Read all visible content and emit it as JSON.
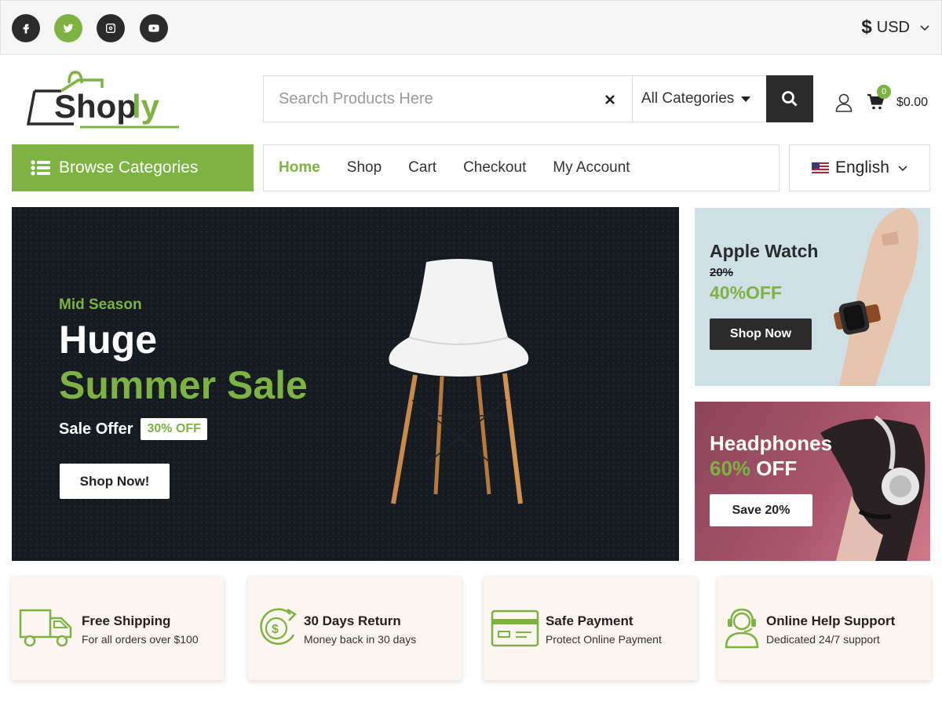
{
  "topbar": {
    "socials": [
      {
        "name": "facebook-icon"
      },
      {
        "name": "twitter-icon",
        "active": true
      },
      {
        "name": "instagram-icon"
      },
      {
        "name": "youtube-icon"
      }
    ],
    "currency": {
      "symbol": "$",
      "code": "USD"
    }
  },
  "header": {
    "logo_text": "Shoply",
    "search": {
      "placeholder": "Search Products Here",
      "value": ""
    },
    "category_select": "All Categories",
    "cart": {
      "count": "0",
      "total": "$0.00"
    }
  },
  "nav": {
    "browse_label": "Browse Categories",
    "links": [
      "Home",
      "Shop",
      "Cart",
      "Checkout",
      "My Account"
    ],
    "active": "Home",
    "language": "English"
  },
  "hero": {
    "subtitle": "Mid Season",
    "title_line1": "Huge",
    "title_line2": "Summer Sale",
    "offer_label": "Sale Offer",
    "offer_badge": "30% OFF",
    "button": "Shop Now!"
  },
  "banner_watch": {
    "title": "Apple Watch",
    "old_discount": "20%",
    "new_discount": "40%OFF",
    "button": "Shop Now"
  },
  "banner_headphones": {
    "title": "Headphones",
    "discount": "60%",
    "discount_suffix": "OFF",
    "button": "Save 20%"
  },
  "features": [
    {
      "title": "Free Shipping",
      "desc": "For all orders over $100",
      "icon": "truck-icon"
    },
    {
      "title": "30 Days Return",
      "desc": "Money back in 30 days",
      "icon": "money-return-icon"
    },
    {
      "title": "Safe Payment",
      "desc": "Protect Online Payment",
      "icon": "credit-card-icon"
    },
    {
      "title": "Online Help Support",
      "desc": "Dedicated 24/7 support",
      "icon": "support-agent-icon"
    }
  ],
  "colors": {
    "accent": "#7cb342",
    "dark": "#2b2b2b",
    "feature_bg": "#fdf5ef"
  }
}
